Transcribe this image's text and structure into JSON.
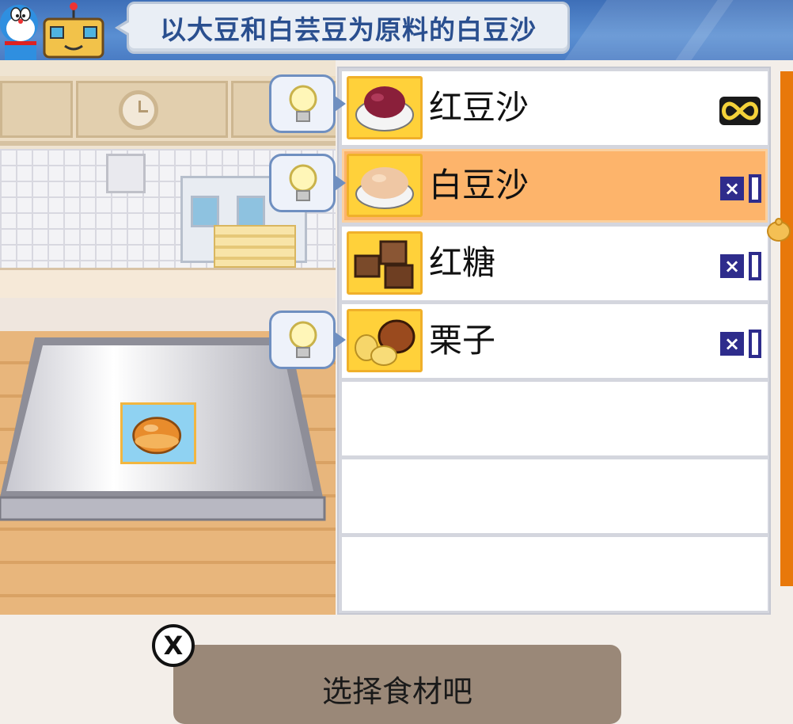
{
  "header": {
    "title": "以大豆和白芸豆为原料的白豆沙",
    "characters": [
      "doraemon-icon",
      "robot-icon"
    ]
  },
  "ingredients": [
    {
      "name": "红豆沙",
      "icon": "red-bean-paste-icon",
      "quantity_icon": "infinity-icon",
      "selected": false,
      "hint": true
    },
    {
      "name": "白豆沙",
      "icon": "white-bean-paste-icon",
      "quantity_icon": "x1-counter",
      "selected": true,
      "hint": true
    },
    {
      "name": "红糖",
      "icon": "brown-sugar-icon",
      "quantity_icon": "x1-counter",
      "selected": false,
      "hint": false
    },
    {
      "name": "栗子",
      "icon": "chestnut-icon",
      "quantity_icon": "x1-counter",
      "selected": false,
      "hint": true
    }
  ],
  "empty_slots": 3,
  "prompt": {
    "text": "选择食材吧",
    "close_label": "X"
  },
  "colors": {
    "header_blue": "#4a7cc4",
    "selected_row": "#fdb46b",
    "scrollbar": "#e8780a",
    "counter_blue": "#2e2c8c"
  }
}
